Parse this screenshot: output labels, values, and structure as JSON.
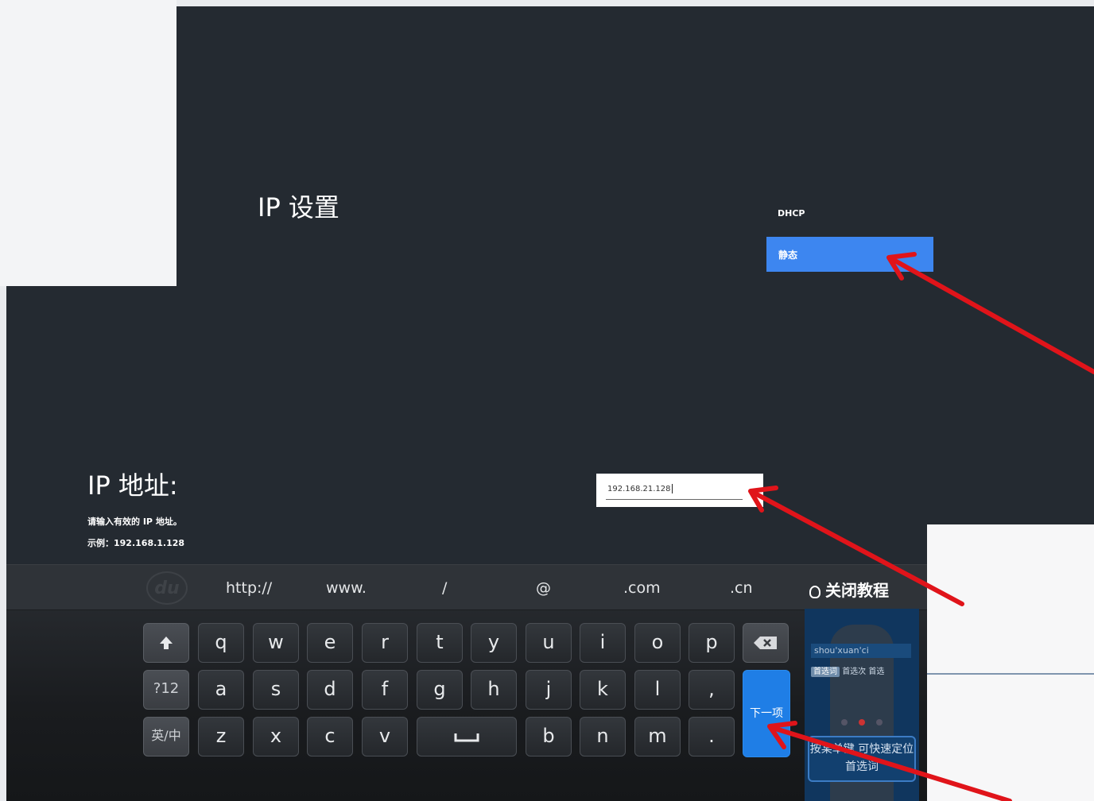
{
  "page": {
    "title": "IP 设置",
    "mode_options": [
      {
        "label": "DHCP",
        "selected": false
      },
      {
        "label": "静态",
        "selected": true
      }
    ]
  },
  "ip_field": {
    "label": "IP 地址:",
    "hint": "请输入有效的 IP 地址。",
    "example": "示例：192.168.1.128",
    "value": "192.168.21.128"
  },
  "keyboard": {
    "suggestions": [
      "http://",
      "www.",
      "/",
      "@",
      ".com",
      ".cn"
    ],
    "close_tutorial": "关闭教程",
    "row1": [
      "q",
      "w",
      "e",
      "r",
      "t",
      "y",
      "u",
      "i",
      "o",
      "p"
    ],
    "row2": [
      "a",
      "s",
      "d",
      "f",
      "g",
      "h",
      "j",
      "k",
      "l",
      ","
    ],
    "row3_left": [
      "z",
      "x",
      "c",
      "v"
    ],
    "row3_right": [
      "b",
      "n",
      "m",
      "."
    ],
    "shift_icon": "shift-arrow-up-icon",
    "backspace_icon": "backspace-icon",
    "space_icon": "space-bar-icon",
    "symbols_key": "?12",
    "lang_key": "英/中",
    "next_key": "下一项"
  },
  "tutorial": {
    "pinyin": "shou'xuan'ci",
    "candidates": [
      "首选词",
      "首选次",
      "首选"
    ],
    "note": "按某单键 可快速定位首选词"
  },
  "colors": {
    "panel": "#242a31",
    "accent": "#3d86f0",
    "arrow": "#e0141a"
  }
}
